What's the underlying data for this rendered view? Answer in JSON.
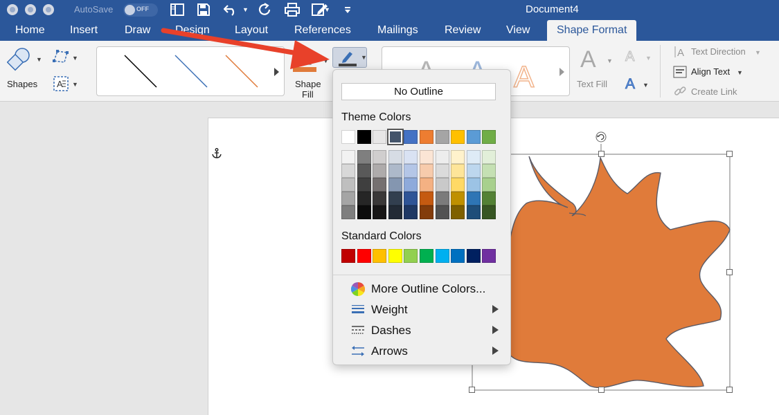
{
  "titlebar": {
    "autosave_label": "AutoSave",
    "autosave_state": "OFF",
    "document_title": "Document4"
  },
  "tabs": [
    {
      "label": "Home"
    },
    {
      "label": "Insert"
    },
    {
      "label": "Draw"
    },
    {
      "label": "Design"
    },
    {
      "label": "Layout"
    },
    {
      "label": "References"
    },
    {
      "label": "Mailings"
    },
    {
      "label": "Review"
    },
    {
      "label": "View"
    },
    {
      "label": "Shape Format",
      "active": true
    }
  ],
  "ribbon": {
    "shapes_label": "Shapes",
    "shape_fill_label_1": "Shape",
    "shape_fill_label_2": "Fill",
    "fill_color": "#e07b3a",
    "text_fill_label": "Text Fill",
    "text_direction_label": "Text Direction",
    "align_text_label": "Align Text",
    "create_link_label": "Create Link",
    "line_styles": [
      {
        "color": "#000000"
      },
      {
        "color": "#3a6fb5"
      },
      {
        "color": "#e07b3a"
      }
    ]
  },
  "outline_menu": {
    "no_outline_label": "No Outline",
    "theme_colors_label": "Theme Colors",
    "standard_colors_label": "Standard Colors",
    "theme_top_row": [
      "#ffffff",
      "#000000",
      "#e7e6e6",
      "#44546a",
      "#4472c4",
      "#ed7d31",
      "#a5a5a5",
      "#ffc000",
      "#5b9bd5",
      "#70ad47"
    ],
    "theme_tints": [
      [
        "#f2f2f2",
        "#7f7f7f",
        "#d0cece",
        "#d6dce4",
        "#d9e2f3",
        "#fbe5d5",
        "#ededed",
        "#fff2cc",
        "#deebf6",
        "#e2efd9"
      ],
      [
        "#d8d8d8",
        "#595959",
        "#aeabab",
        "#adb9ca",
        "#b4c6e7",
        "#f7cbac",
        "#dbdbdb",
        "#fee599",
        "#bdd7ee",
        "#c5e0b3"
      ],
      [
        "#bfbfbf",
        "#3f3f3f",
        "#757070",
        "#8496b0",
        "#8eaadb",
        "#f4b183",
        "#c9c9c9",
        "#ffd965",
        "#9cc3e5",
        "#a8d08d"
      ],
      [
        "#a5a5a5",
        "#262626",
        "#3a3838",
        "#323f4f",
        "#2f5496",
        "#c55a11",
        "#7b7b7b",
        "#bf9000",
        "#2e75b5",
        "#538135"
      ],
      [
        "#7f7f7f",
        "#0c0c0c",
        "#171616",
        "#222a35",
        "#1f3864",
        "#833c0b",
        "#525252",
        "#7f6000",
        "#1f4e79",
        "#375623"
      ]
    ],
    "standard_colors": [
      "#c00000",
      "#ff0000",
      "#ffc000",
      "#ffff00",
      "#92d050",
      "#00b050",
      "#00b0f0",
      "#0070c0",
      "#002060",
      "#7030a0"
    ],
    "selected_theme_index": 3,
    "items": [
      {
        "label": "More Outline Colors...",
        "icon": "color-wheel-icon",
        "submenu": false
      },
      {
        "label": "Weight",
        "icon": "weight-lines-icon",
        "submenu": true
      },
      {
        "label": "Dashes",
        "icon": "dashes-icon",
        "submenu": true
      },
      {
        "label": "Arrows",
        "icon": "arrows-icon",
        "submenu": true
      }
    ]
  },
  "shape": {
    "fill_color": "#e07b3a",
    "outline_color": "#5b5b66"
  },
  "annotation_arrow_color": "#e8412a"
}
